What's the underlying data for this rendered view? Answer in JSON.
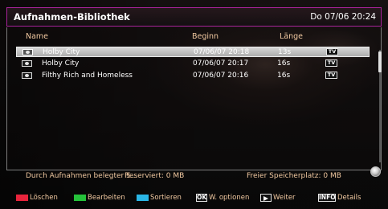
{
  "header": {
    "title": "Aufnahmen-Bibliothek",
    "datetime": "Do 07/06 20:24"
  },
  "columns": {
    "name": "Name",
    "begin": "Beginn",
    "length": "Länge"
  },
  "recordings": [
    {
      "name": "Holby City",
      "date": "07/06/07 20:18",
      "length": "13s",
      "badge": "TV",
      "selected": true
    },
    {
      "name": "Holby City",
      "date": "07/06/07 20:17",
      "length": "16s",
      "badge": "TV",
      "selected": false
    },
    {
      "name": "Filthy Rich and Homeless",
      "date": "07/06/07 20:16",
      "length": "16s",
      "badge": "TV",
      "selected": false
    }
  ],
  "status": {
    "used": "Durch Aufnahmen belegter S...",
    "reserved": "Reserviert: 0 MB",
    "free": "Freier Speicherplatz: 0 MB"
  },
  "footer": {
    "delete": "Löschen",
    "edit": "Bearbeiten",
    "sort": "Sortieren",
    "ok_key": "OK",
    "options": "W. optionen",
    "next": "Weiter",
    "info_key": "INFO",
    "details": "Details"
  },
  "colors": {
    "accent_border": "#a8239a",
    "red_key": "#e8243c",
    "green_key": "#25c23a",
    "cyan_key": "#2ab6e6",
    "label_text": "#f0c8a0"
  }
}
